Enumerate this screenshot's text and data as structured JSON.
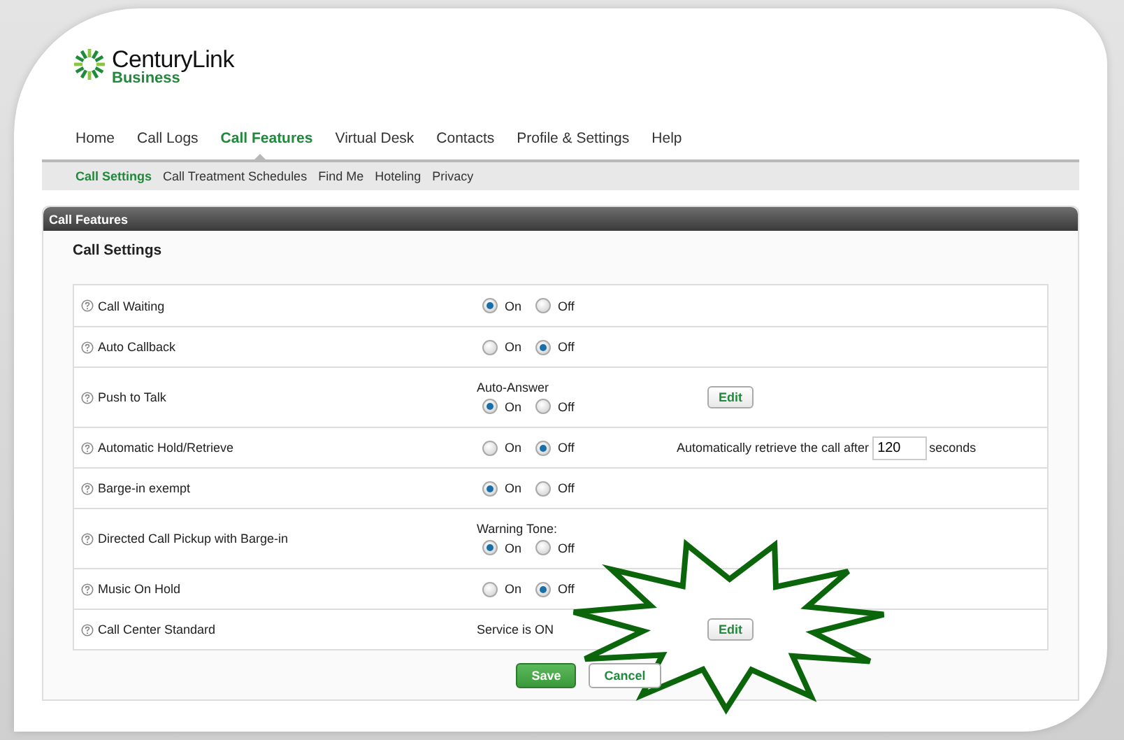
{
  "brand": {
    "name": "CenturyLink",
    "tagline": "Business"
  },
  "nav": [
    {
      "label": "Home",
      "selected": false
    },
    {
      "label": "Call Logs",
      "selected": false
    },
    {
      "label": "Call Features",
      "selected": true
    },
    {
      "label": "Virtual Desk",
      "selected": false
    },
    {
      "label": "Contacts",
      "selected": false
    },
    {
      "label": "Profile & Settings",
      "selected": false
    },
    {
      "label": "Help",
      "selected": false
    }
  ],
  "subnav": [
    {
      "label": "Call Settings",
      "selected": true
    },
    {
      "label": "Call Treatment Schedules",
      "selected": false
    },
    {
      "label": "Find Me",
      "selected": false
    },
    {
      "label": "Hoteling",
      "selected": false
    },
    {
      "label": "Privacy",
      "selected": false
    }
  ],
  "panel": {
    "title": "Call Features",
    "heading": "Call Settings",
    "rows": [
      {
        "label": "Call Waiting",
        "kind": "radio",
        "options": [
          {
            "label": "On",
            "selected": true
          },
          {
            "label": "Off",
            "selected": false
          }
        ]
      },
      {
        "label": "Auto Callback",
        "kind": "radio",
        "options": [
          {
            "label": "On",
            "selected": false
          },
          {
            "label": "Off",
            "selected": true
          }
        ]
      },
      {
        "label": "Push to Talk",
        "kind": "radio",
        "caption": "Auto-Answer",
        "options": [
          {
            "label": "On",
            "selected": true
          },
          {
            "label": "Off",
            "selected": false
          }
        ],
        "action": "Edit"
      },
      {
        "label": "Automatic Hold/Retrieve",
        "kind": "radio",
        "options": [
          {
            "label": "On",
            "selected": false
          },
          {
            "label": "Off",
            "selected": true
          }
        ],
        "extra": {
          "prefix": "Automatically retrieve the call after",
          "value": "120",
          "suffix": "seconds"
        }
      },
      {
        "label": "Barge-in exempt",
        "kind": "radio",
        "options": [
          {
            "label": "On",
            "selected": true
          },
          {
            "label": "Off",
            "selected": false
          }
        ]
      },
      {
        "label": "Directed Call Pickup with Barge-in",
        "kind": "radio",
        "caption": "Warning Tone:",
        "options": [
          {
            "label": "On",
            "selected": true
          },
          {
            "label": "Off",
            "selected": false
          }
        ]
      },
      {
        "label": "Music On Hold",
        "kind": "radio",
        "options": [
          {
            "label": "On",
            "selected": false
          },
          {
            "label": "Off",
            "selected": true
          }
        ]
      },
      {
        "label": "Call Center Standard",
        "kind": "status",
        "status": "Service is ON",
        "action": "Edit"
      }
    ],
    "buttons": [
      {
        "label": "Save",
        "kind": "primary"
      },
      {
        "label": "Cancel",
        "kind": "secondary"
      }
    ]
  }
}
